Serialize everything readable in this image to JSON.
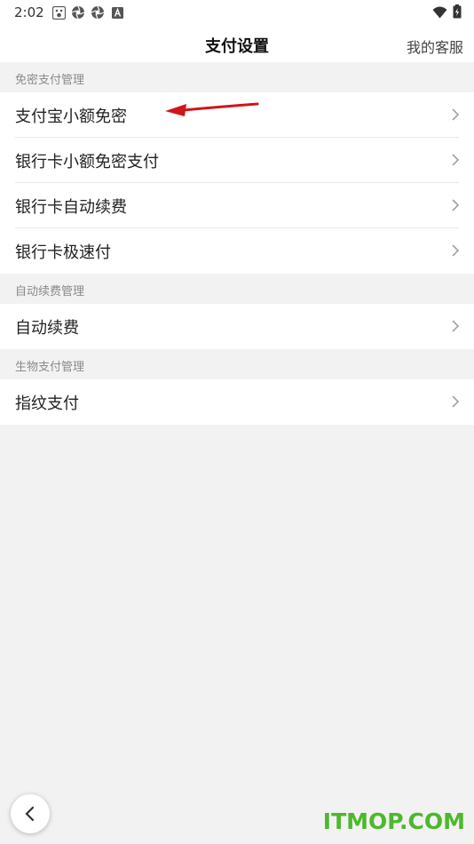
{
  "status_bar": {
    "time": "2:02",
    "icons": [
      "baidu-icon",
      "aperture-icon",
      "aperture-icon",
      "a-badge-icon"
    ],
    "right_icons": [
      "wifi-icon",
      "battery-icon"
    ]
  },
  "nav": {
    "title": "支付设置",
    "action": "我的客服"
  },
  "sections": [
    {
      "header": "免密支付管理",
      "items": [
        "支付宝小额免密",
        "银行卡小额免密支付",
        "银行卡自动续费",
        "银行卡极速付"
      ]
    },
    {
      "header": "自动续费管理",
      "items": [
        "自动续费"
      ]
    },
    {
      "header": "生物支付管理",
      "items": [
        "指纹支付"
      ]
    }
  ],
  "watermark": "ITMOP.COM",
  "colors": {
    "background": "#f2f2f2",
    "row_background": "#ffffff",
    "annotation_arrow": "#d0151b",
    "watermark": "#4db82e"
  }
}
